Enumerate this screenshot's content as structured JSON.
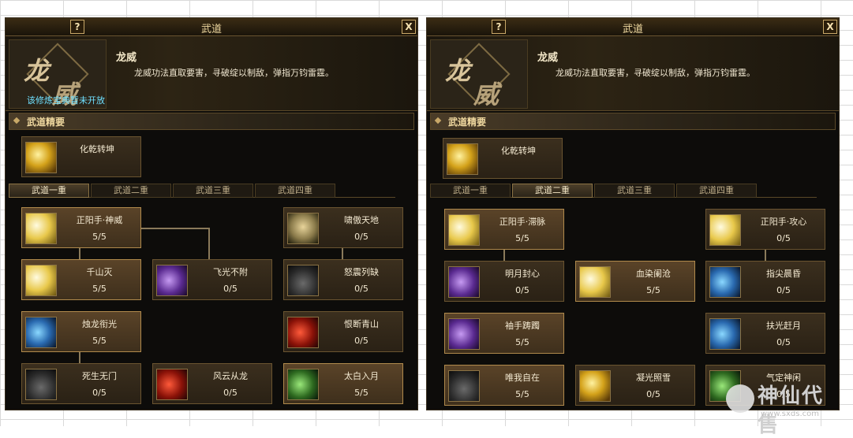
{
  "panels": [
    {
      "title": "武道",
      "help_label": "?",
      "close_label": "X",
      "skill_name": "龙威",
      "skill_desc": "龙威功法直取要害，寻破绽以制敌，弹指万钧雷霆。",
      "emblem_note": "该修炼宝典暂未开放",
      "section_title": "武道精要",
      "featured": {
        "name": "化乾转坤",
        "icon": "gold-claw-icon"
      },
      "tabs": [
        "武道一重",
        "武道二重",
        "武道三重",
        "武道四重"
      ],
      "active_tab": 0,
      "skills": [
        {
          "name": "正阳手·神威",
          "count": "5/5",
          "icon": "yellow-palm-icon",
          "selected": true
        },
        {
          "name": "啸傲天地",
          "count": "0/5",
          "icon": "face-icon",
          "selected": false
        },
        {
          "name": "千山灭",
          "count": "5/5",
          "icon": "yellow-palm-icon",
          "selected": true
        },
        {
          "name": "飞光不附",
          "count": "0/5",
          "icon": "purple-palm-icon",
          "selected": false
        },
        {
          "name": "怒震列缺",
          "count": "0/5",
          "icon": "dark-burst-icon",
          "selected": false
        },
        {
          "name": "烛龙衔光",
          "count": "5/5",
          "icon": "blue-palm-icon",
          "selected": true
        },
        {
          "name": "恨断青山",
          "count": "0/5",
          "icon": "red-slash-icon",
          "selected": false
        },
        {
          "name": "死生无门",
          "count": "0/5",
          "icon": "dark-burst-icon",
          "selected": false
        },
        {
          "name": "风云从龙",
          "count": "0/5",
          "icon": "red-slash-icon",
          "selected": false
        },
        {
          "name": "太白入月",
          "count": "5/5",
          "icon": "green-red-icon",
          "selected": true
        }
      ]
    },
    {
      "title": "武道",
      "help_label": "?",
      "close_label": "X",
      "skill_name": "龙威",
      "skill_desc": "龙威功法直取要害，寻破绽以制敌，弹指万钧雷霆。",
      "section_title": "武道精要",
      "featured": {
        "name": "化乾转坤",
        "icon": "gold-claw-icon"
      },
      "tabs": [
        "武道一重",
        "武道二重",
        "武道三重",
        "武道四重"
      ],
      "active_tab": 1,
      "skills": [
        {
          "name": "正阳手·滞脉",
          "count": "5/5",
          "icon": "yellow-palm-icon",
          "selected": true
        },
        {
          "name": "正阳手·攻心",
          "count": "0/5",
          "icon": "yellow-palm-icon",
          "selected": false
        },
        {
          "name": "明月封心",
          "count": "0/5",
          "icon": "purple-palm-icon",
          "selected": false
        },
        {
          "name": "血染阑沧",
          "count": "5/5",
          "icon": "yellow-palm-icon",
          "selected": true
        },
        {
          "name": "指尖晨昏",
          "count": "0/5",
          "icon": "blue-palm-icon",
          "selected": false
        },
        {
          "name": "袖手踌躅",
          "count": "5/5",
          "icon": "purple-palm-icon",
          "selected": true
        },
        {
          "name": "扶光赶月",
          "count": "0/5",
          "icon": "blue-palm-icon",
          "selected": false
        },
        {
          "name": "唯我自在",
          "count": "5/5",
          "icon": "dark-figure-icon",
          "selected": true
        },
        {
          "name": "凝光照雪",
          "count": "0/5",
          "icon": "gold-claw-icon",
          "selected": false
        },
        {
          "name": "气定神闲",
          "count": "0/5",
          "icon": "green-red-icon",
          "selected": false
        }
      ]
    }
  ],
  "watermark": {
    "text": "神仙代售",
    "url": "www.sxds.com"
  }
}
